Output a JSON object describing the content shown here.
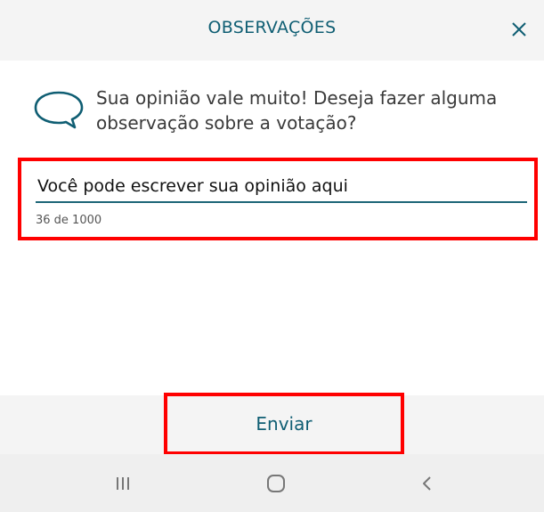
{
  "header": {
    "title": "OBSERVAÇÕES",
    "close_icon": "close-icon"
  },
  "prompt": {
    "icon": "speech-bubble-icon",
    "text": "Sua opinião vale muito! Deseja fazer alguma observação sobre a votação?"
  },
  "opinion": {
    "value": "Você pode escrever sua opinião aqui",
    "counter": "36 de 1000"
  },
  "footer": {
    "send_label": "Enviar"
  },
  "navbar": {
    "recent_icon": "recent-apps-icon",
    "home_icon": "home-icon",
    "back_icon": "back-icon"
  },
  "colors": {
    "accent": "#0f5e73",
    "highlight": "#ff0000",
    "bar_background": "#f4f4f4"
  }
}
